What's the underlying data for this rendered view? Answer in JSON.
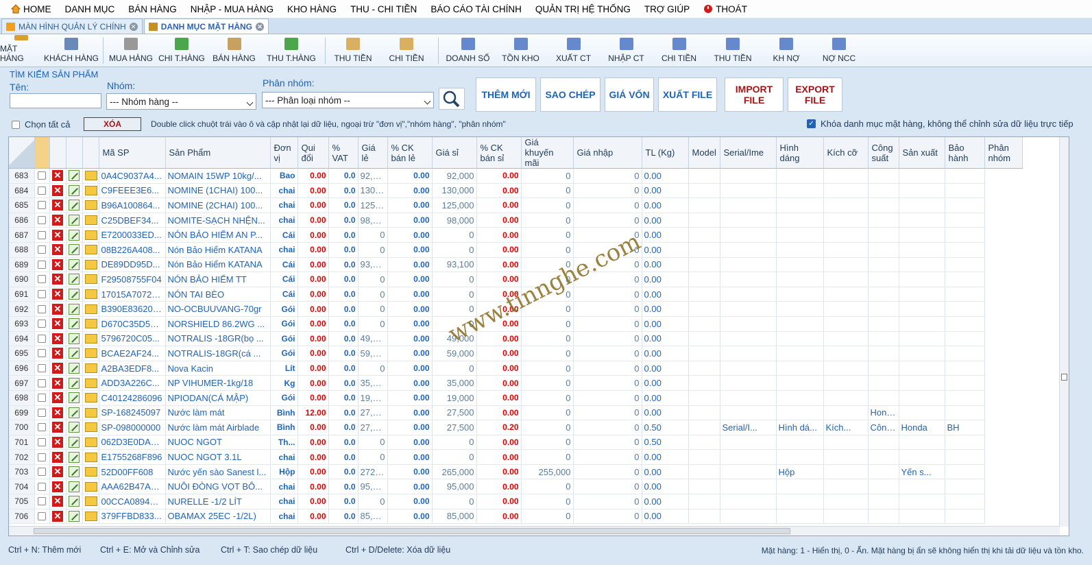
{
  "menu": [
    "HOME",
    "DANH MỤC",
    "BÁN HÀNG",
    "NHẬP - MUA HÀNG",
    "KHO HÀNG",
    "THU - CHI TIỀN",
    "BÁO CÁO TÀI CHÍNH",
    "QUẢN TRỊ HỆ THỐNG",
    "TRỢ GIÚP",
    "THOÁT"
  ],
  "tabs": [
    "MÀN HÌNH QUẢN LÝ CHÍNH",
    "DANH MỤC MẶT HÀNG"
  ],
  "toolbar": [
    "MẶT HÀNG",
    "KHÁCH HÀNG",
    "MUA HÀNG",
    "CHI T.HÀNG",
    "BÁN HÀNG",
    "THU T.HÀNG",
    "THU TIỀN",
    "CHI TIỀN",
    "DOANH SỐ",
    "TỒN KHO",
    "XUẤT CT",
    "NHẬP CT",
    "CHI TIỀN",
    "THU TIỀN",
    "KH NỢ",
    "NỢ NCC"
  ],
  "search": {
    "title": "TÌM KIẾM SẢN PHẨM",
    "name_label": "Tên:",
    "group_label": "Nhóm:",
    "subgroup_label": "Phân nhóm:",
    "group_value": "--- Nhóm hàng --",
    "subgroup_value": "--- Phân loại nhóm --",
    "select_all": "Chọn tất cả",
    "delete": "XÓA",
    "hint": "Double click chuột trái vào ô và cập nhật lại dữ liệu, ngoại trừ \"đơn vị\",\"nhóm hàng\", \"phân nhóm\"",
    "lock": "Khóa danh mục mặt hàng, không thể chỉnh sửa dữ liệu trực tiếp"
  },
  "buttons": [
    "THÊM MỚI",
    "SAO CHÉP",
    "GIÁ VỐN",
    "XUẤT FILE",
    "IMPORT FILE",
    "EXPORT FILE"
  ],
  "columns": [
    "Mã SP",
    "Sản Phẩm",
    "Đơn vị",
    "Qui đổi",
    "% VAT",
    "Giá lẻ",
    "% CK bán lẻ",
    "Giá sỉ",
    "% CK bán sỉ",
    "Giá khuyến mãi",
    "Giá nhập",
    "TL (Kg)",
    "Model",
    "Serial/Ime",
    "Hình dáng",
    "Kích cỡ",
    "Công suất",
    "Sản xuất",
    "Bảo hành",
    "Phân nhóm"
  ],
  "rows": [
    [
      "683",
      "0A4C9037A4...",
      "NOMAIN 15WP 10kg/...",
      "Bao",
      "0.00",
      "0.0",
      "92,000",
      "0.00",
      "92,000",
      "0.00",
      "0",
      "0",
      "0.00",
      "",
      "",
      "",
      "",
      "",
      "",
      ""
    ],
    [
      "684",
      "C9FEEE3E6...",
      "NOMINE  (1CHAI) 100...",
      "chai",
      "0.00",
      "0.0",
      "130,000",
      "0.00",
      "130,000",
      "0.00",
      "0",
      "0",
      "0.00",
      "",
      "",
      "",
      "",
      "",
      "",
      ""
    ],
    [
      "685",
      "B96A100864...",
      "NOMINE  (2CHAI) 100...",
      "chai",
      "0.00",
      "0.0",
      "125,000",
      "0.00",
      "125,000",
      "0.00",
      "0",
      "0",
      "0.00",
      "",
      "",
      "",
      "",
      "",
      "",
      ""
    ],
    [
      "686",
      "C25DBEF34...",
      "NOMITE-SẠCH NHỆN...",
      "chai",
      "0.00",
      "0.0",
      "98,000",
      "0.00",
      "98,000",
      "0.00",
      "0",
      "0",
      "0.00",
      "",
      "",
      "",
      "",
      "",
      "",
      ""
    ],
    [
      "687",
      "E7200033ED...",
      "NÓN BẢO HIỂM AN P...",
      "Cái",
      "0.00",
      "0.0",
      "0",
      "0.00",
      "0",
      "0.00",
      "0",
      "0",
      "0.00",
      "",
      "",
      "",
      "",
      "",
      "",
      ""
    ],
    [
      "688",
      "08B226A408...",
      "Nón Bảo Hiểm KATANA",
      "chai",
      "0.00",
      "0.0",
      "0",
      "0.00",
      "0",
      "0.00",
      "0",
      "0",
      "0.00",
      "",
      "",
      "",
      "",
      "",
      "",
      ""
    ],
    [
      "689",
      "DE89DD95D...",
      "Nón Bảo Hiểm KATANA",
      "Cái",
      "0.00",
      "0.0",
      "93,100",
      "0.00",
      "93,100",
      "0.00",
      "0",
      "0",
      "0.00",
      "",
      "",
      "",
      "",
      "",
      "",
      ""
    ],
    [
      "690",
      "F29508755F04",
      "NÓN BẢO HIỂM TT",
      "Cái",
      "0.00",
      "0.0",
      "0",
      "0.00",
      "0",
      "0.00",
      "0",
      "0",
      "0.00",
      "",
      "",
      "",
      "",
      "",
      "",
      ""
    ],
    [
      "691",
      "17015A7072D0",
      "NÓN TAI BÈO",
      "Cái",
      "0.00",
      "0.0",
      "0",
      "0.00",
      "0",
      "0.00",
      "0",
      "0",
      "0.00",
      "",
      "",
      "",
      "",
      "",
      "",
      ""
    ],
    [
      "692",
      "B390E836205F",
      "NO-OCBUUVANG-70gr",
      "Gói",
      "0.00",
      "0.0",
      "0",
      "0.00",
      "0",
      "0.00",
      "0",
      "0",
      "0.00",
      "",
      "",
      "",
      "",
      "",
      "",
      ""
    ],
    [
      "693",
      "D670C35D5C...",
      "NORSHIELD 86.2WG ...",
      "Gói",
      "0.00",
      "0.0",
      "0",
      "0.00",
      "0",
      "0.00",
      "0",
      "0",
      "0.00",
      "",
      "",
      "",
      "",
      "",
      "",
      ""
    ],
    [
      "694",
      "5796720C05...",
      "NOTRALIS -18GR(bọ ...",
      "Gói",
      "0.00",
      "0.0",
      "49,000",
      "0.00",
      "49,000",
      "0.00",
      "0",
      "0",
      "0.00",
      "",
      "",
      "",
      "",
      "",
      "",
      ""
    ],
    [
      "695",
      "BCAE2AF24...",
      "NOTRALIS-18GR(cá ...",
      "Gói",
      "0.00",
      "0.0",
      "59,000",
      "0.00",
      "59,000",
      "0.00",
      "0",
      "0",
      "0.00",
      "",
      "",
      "",
      "",
      "",
      "",
      ""
    ],
    [
      "696",
      "A2BA3EDF8...",
      "Nova Kacin",
      "Lít",
      "0.00",
      "0.0",
      "0",
      "0.00",
      "0",
      "0.00",
      "0",
      "0",
      "0.00",
      "",
      "",
      "",
      "",
      "",
      "",
      ""
    ],
    [
      "697",
      "ADD3A226C...",
      "NP VIHUMER-1kg/18",
      "Kg",
      "0.00",
      "0.0",
      "35,000",
      "0.00",
      "35,000",
      "0.00",
      "0",
      "0",
      "0.00",
      "",
      "",
      "",
      "",
      "",
      "",
      ""
    ],
    [
      "698",
      "C40124286096",
      "NPIODAN(CÁ MẬP)",
      "Gói",
      "0.00",
      "0.0",
      "19,000",
      "0.00",
      "19,000",
      "0.00",
      "0",
      "0",
      "0.00",
      "",
      "",
      "",
      "",
      "",
      "",
      ""
    ],
    [
      "699",
      "SP-168245097",
      "Nước làm mát",
      "Bình",
      "12.00",
      "0.0",
      "27,500",
      "0.00",
      "27,500",
      "0.00",
      "0",
      "0",
      "0.00",
      "",
      "",
      "",
      "",
      "Honda",
      "",
      ""
    ],
    [
      "700",
      "SP-098000000",
      "Nước làm mát Airblade",
      "Bình",
      "0.00",
      "0.0",
      "27,500",
      "0.00",
      "27,500",
      "0.20",
      "0",
      "0",
      "0.50",
      "",
      "Serial/I...",
      "Hình dá...",
      "Kích...",
      "Công su...",
      "Honda",
      "BH"
    ],
    [
      "701",
      "062D3E0DA1...",
      "NUOC NGOT",
      "Th...",
      "0.00",
      "0.0",
      "0",
      "0.00",
      "0",
      "0.00",
      "0",
      "0",
      "0.50",
      "",
      "",
      "",
      "",
      "",
      "",
      ""
    ],
    [
      "702",
      "E1755268F896",
      "NUOC NGOT 3.1L",
      "chai",
      "0.00",
      "0.0",
      "0",
      "0.00",
      "0",
      "0.00",
      "0",
      "0",
      "0.00",
      "",
      "",
      "",
      "",
      "",
      "",
      ""
    ],
    [
      "703",
      "52D00FF608",
      "Nước yến sào Sanest l...",
      "Hộp",
      "0.00",
      "0.0",
      "272,000",
      "0.00",
      "265,000",
      "0.00",
      "255,000",
      "0",
      "0.00",
      "",
      "",
      "Hộp",
      "",
      "",
      "Yến s...",
      ""
    ],
    [
      "704",
      "AAA62B47A6...",
      "NUÔI ĐÒNG VỌT BÔ...",
      "chai",
      "0.00",
      "0.0",
      "95,000",
      "0.00",
      "95,000",
      "0.00",
      "0",
      "0",
      "0.00",
      "",
      "",
      "",
      "",
      "",
      "",
      ""
    ],
    [
      "705",
      "00CCA0894E...",
      "NURELLE -1/2 LÍT",
      "chai",
      "0.00",
      "0.0",
      "0",
      "0.00",
      "0",
      "0.00",
      "0",
      "0",
      "0.00",
      "",
      "",
      "",
      "",
      "",
      "",
      ""
    ],
    [
      "706",
      "379FFBD833...",
      "OBAMAX 25EC -1/2L)",
      "chai",
      "0.00",
      "0.0",
      "85,000",
      "0.00",
      "85,000",
      "0.00",
      "0",
      "0",
      "0.00",
      "",
      "",
      "",
      "",
      "",
      "",
      ""
    ]
  ],
  "footer": {
    "new": "Ctrl + N: Thêm mới",
    "edit": "Ctrl + E:  Mở và Chỉnh sửa",
    "copy": "Ctrl + T:  Sao chép dữ liệu",
    "del": "Ctrl + D/Delete:  Xóa dữ liệu",
    "note": "Mặt hàng: 1 - Hiển thị, 0 - Ẩn. Mặt hàng bị ẩn sẽ không hiển thị khi tải dữ liệu và tồn kho."
  },
  "watermark": "www.tinnghe.com",
  "colors": {
    "accent": "#1f63b7",
    "red": "#e00000"
  }
}
